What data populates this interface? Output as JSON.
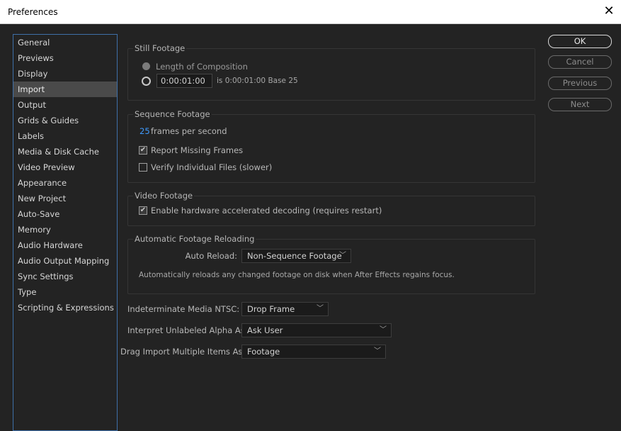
{
  "window": {
    "title": "Preferences",
    "close_glyph": "✕"
  },
  "sidebar": {
    "selected": "Import",
    "items": [
      "General",
      "Previews",
      "Display",
      "Import",
      "Output",
      "Grids & Guides",
      "Labels",
      "Media & Disk Cache",
      "Video Preview",
      "Appearance",
      "New Project",
      "Auto-Save",
      "Memory",
      "Audio Hardware",
      "Audio Output Mapping",
      "Sync Settings",
      "Type",
      "Scripting & Expressions"
    ]
  },
  "buttons": {
    "ok": "OK",
    "cancel": "Cancel",
    "previous": "Previous",
    "next": "Next"
  },
  "still_footage": {
    "title": "Still Footage",
    "length_option": "Length of Composition",
    "duration_value": "0:00:01:00",
    "duration_info": "is 0:00:01:00  Base 25"
  },
  "sequence_footage": {
    "title": "Sequence Footage",
    "fps_value": "25",
    "fps_label": "frames per second",
    "report_missing": "Report Missing Frames",
    "verify_files": "Verify Individual Files (slower)"
  },
  "video_footage": {
    "title": "Video Footage",
    "hw_decoding": "Enable hardware accelerated decoding (requires restart)"
  },
  "auto_reload": {
    "title": "Automatic Footage Reloading",
    "label": "Auto Reload:",
    "value": "Non-Sequence Footage",
    "description": "Automatically reloads any changed footage on disk when After Effects regains focus."
  },
  "settings": {
    "ntsc_label": "Indeterminate Media NTSC:",
    "ntsc_value": "Drop Frame",
    "alpha_label": "Interpret Unlabeled Alpha As:",
    "alpha_value": "Ask User",
    "drag_label": "Drag Import Multiple Items As:",
    "drag_value": "Footage"
  },
  "colors": {
    "accent": "#3f9bff",
    "sidebar_border": "#3e6fa8",
    "background": "#232323"
  }
}
